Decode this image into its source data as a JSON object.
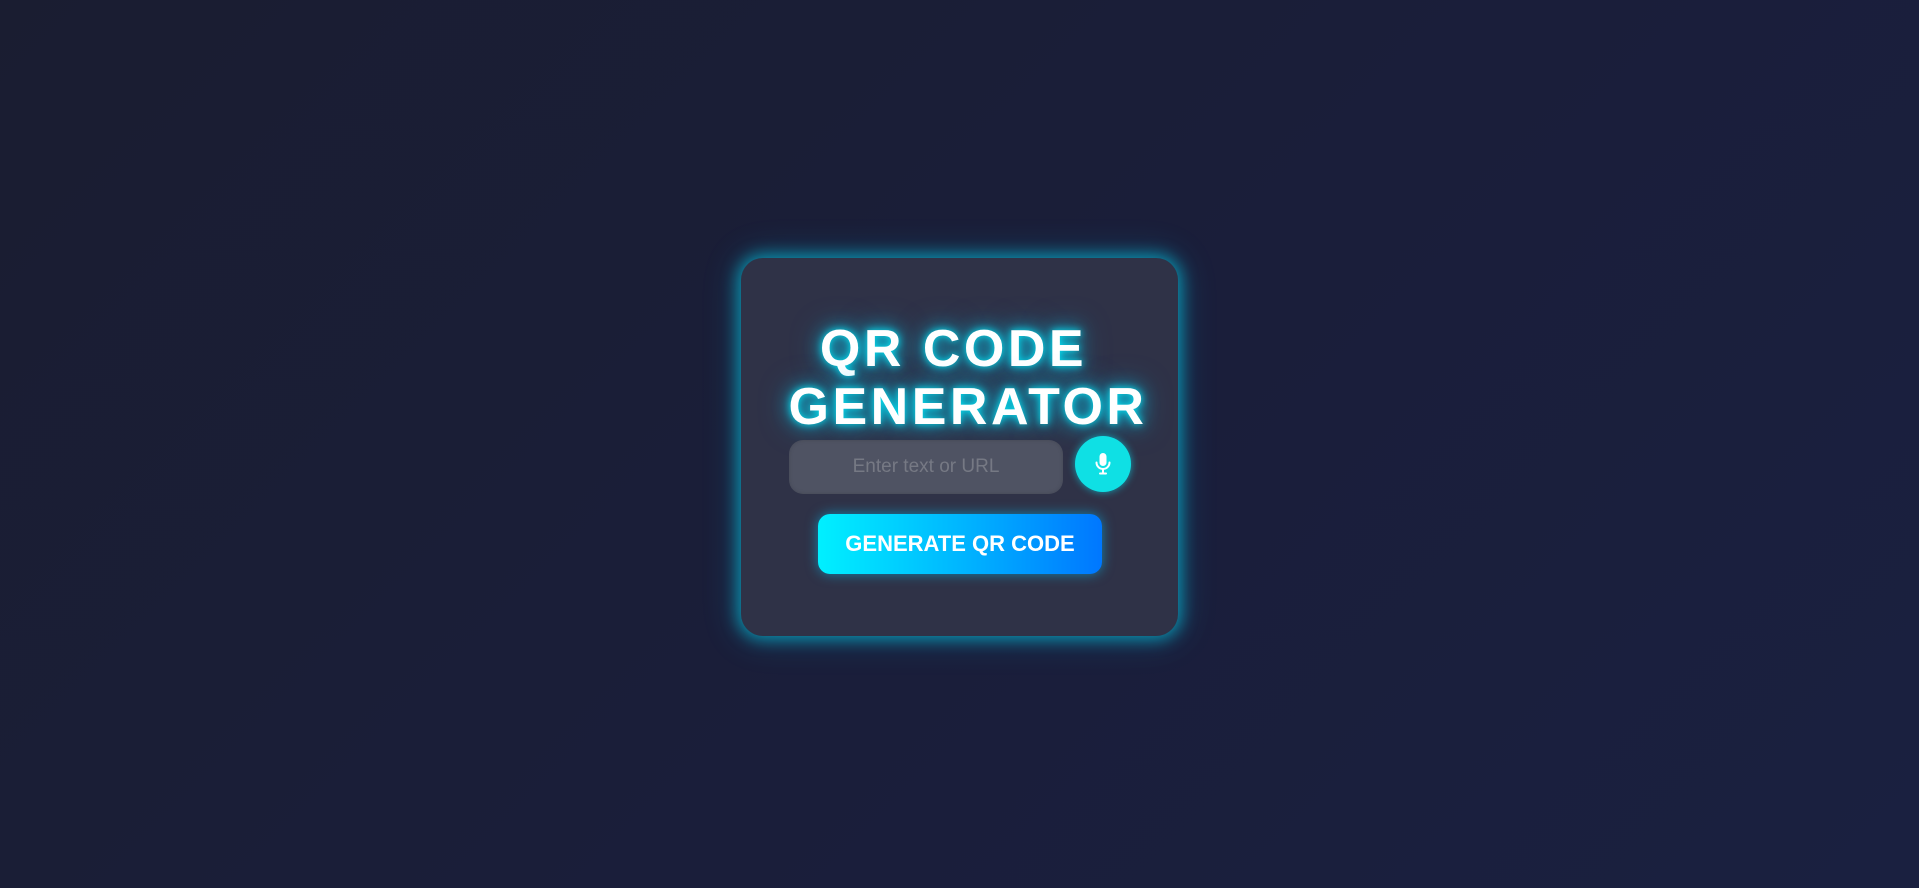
{
  "app": {
    "title_line1": "QR CODE",
    "title_line2": "GENERATOR"
  },
  "input": {
    "value": "",
    "placeholder": "Enter text or URL"
  },
  "mic_button": {
    "icon": "microphone-icon"
  },
  "generate_button": {
    "label": "GENERATE QR CODE"
  },
  "colors": {
    "background": "#1b1e35",
    "card": "#2f3247",
    "accent_cyan": "#0fe0e4",
    "button_gradient_start": "#00f0ff",
    "button_gradient_end": "#0077ff",
    "glow": "#00e6ff"
  }
}
